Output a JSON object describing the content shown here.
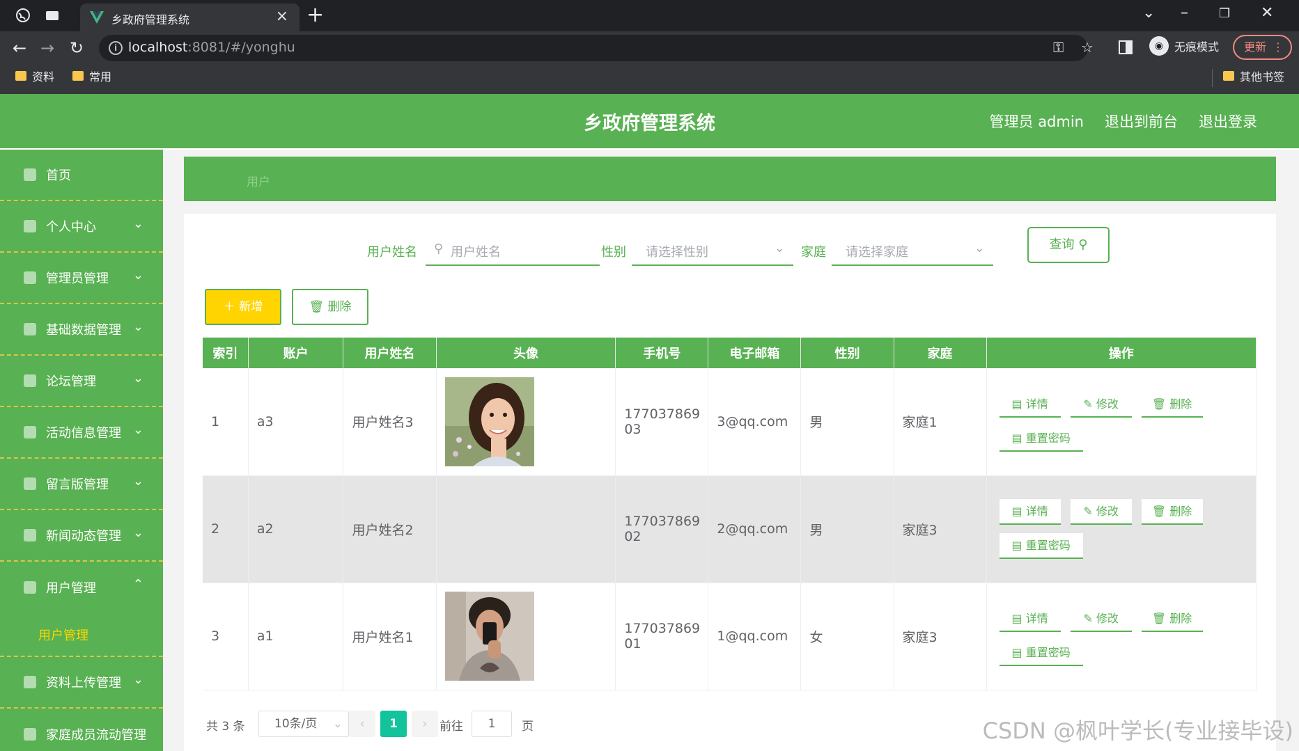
{
  "browser": {
    "tab_title": "乡政府管理系统",
    "tab_close": "×",
    "new_tab": "+",
    "url_host": "localhost",
    "url_rest": ":8081/#/yonghu",
    "incognito_label": "无痕模式",
    "update_label": "更新",
    "bookmarks": [
      "资料",
      "常用"
    ],
    "other_bookmarks": "其他书签"
  },
  "header": {
    "title": "乡政府管理系统",
    "links": [
      "管理员 admin",
      "退出到前台",
      "退出登录"
    ]
  },
  "sidebar": {
    "items": [
      {
        "label": "首页",
        "icon": "home-icon",
        "expandable": false
      },
      {
        "label": "个人中心",
        "icon": "user-icon",
        "expandable": true
      },
      {
        "label": "管理员管理",
        "icon": "admin-icon",
        "expandable": true
      },
      {
        "label": "基础数据管理",
        "icon": "data-icon",
        "expandable": true
      },
      {
        "label": "论坛管理",
        "icon": "forum-icon",
        "expandable": true
      },
      {
        "label": "活动信息管理",
        "icon": "calendar-icon",
        "expandable": true
      },
      {
        "label": "留言版管理",
        "icon": "message-icon",
        "expandable": true
      },
      {
        "label": "新闻动态管理",
        "icon": "news-icon",
        "expandable": true
      },
      {
        "label": "用户管理",
        "icon": "users-icon",
        "expandable": true,
        "expanded": true
      },
      {
        "label": "资料上传管理",
        "icon": "upload-icon",
        "expandable": true
      },
      {
        "label": "家庭成员流动管理",
        "icon": "family-icon",
        "expandable": false
      }
    ],
    "active_submenu": "用户管理"
  },
  "breadcrumb": "用户",
  "search": {
    "name_label": "用户姓名",
    "name_placeholder": "用户姓名",
    "gender_label": "性别",
    "gender_placeholder": "请选择性别",
    "family_label": "家庭",
    "family_placeholder": "请选择家庭",
    "query_button": "查询"
  },
  "actions": {
    "add": "新增",
    "delete": "删除"
  },
  "table": {
    "columns": [
      "索引",
      "账户",
      "用户姓名",
      "头像",
      "手机号",
      "电子邮箱",
      "性别",
      "家庭",
      "操作"
    ],
    "rows": [
      {
        "index": "1",
        "account": "a3",
        "name": "用户姓名3",
        "avatar": "girl-photo",
        "phone_line1": "177037869",
        "phone_line2": "03",
        "email": "3@qq.com",
        "gender": "男",
        "family": "家庭1"
      },
      {
        "index": "2",
        "account": "a2",
        "name": "用户姓名2",
        "avatar": "",
        "phone_line1": "177037869",
        "phone_line2": "02",
        "email": "2@qq.com",
        "gender": "男",
        "family": "家庭3"
      },
      {
        "index": "3",
        "account": "a1",
        "name": "用户姓名1",
        "avatar": "boy-photo",
        "phone_line1": "177037869",
        "phone_line2": "01",
        "email": "1@qq.com",
        "gender": "女",
        "family": "家庭3"
      }
    ],
    "row_ops": {
      "detail": "详情",
      "edit": "修改",
      "delete": "删除",
      "reset": "重置密码"
    }
  },
  "pagination": {
    "total": "共 3 条",
    "page_size": "10条/页",
    "prev": "‹",
    "current": "1",
    "next": "›",
    "goto_label": "前往",
    "goto_value": "1",
    "page_suffix": "页"
  },
  "watermark": "CSDN @枫叶学长(专业接毕设)",
  "colors": {
    "brand_green": "#58b152",
    "accent_yellow": "#ffd400",
    "pager_active": "#13c39b"
  }
}
